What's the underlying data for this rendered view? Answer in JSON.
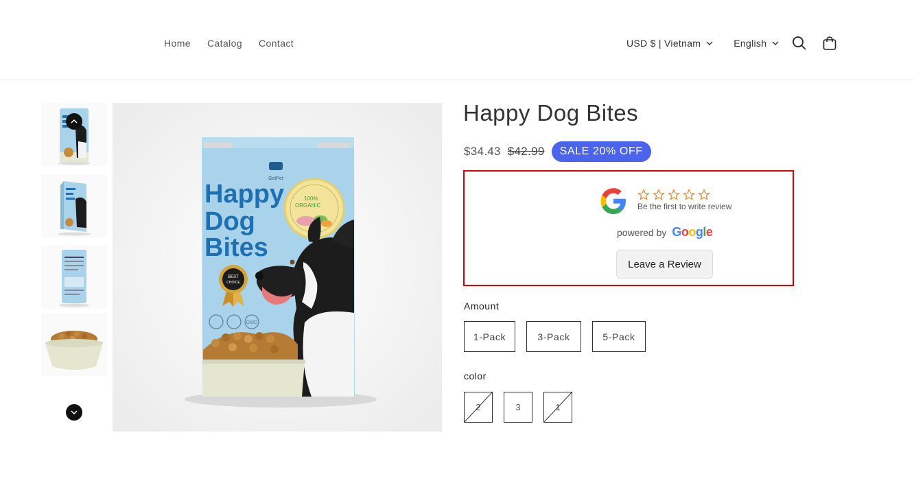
{
  "nav": {
    "home": "Home",
    "catalog": "Catalog",
    "contact": "Contact"
  },
  "header": {
    "currency": "USD $ | Vietnam",
    "language": "English"
  },
  "product": {
    "title": "Happy Dog Bites",
    "price": "$34.43",
    "compare_price": "$42.99",
    "badge": "SALE 20% OFF"
  },
  "package_art": {
    "brand": "GetPet",
    "line1": "Happy",
    "line2": "Dog",
    "line3": "Bites",
    "seal_line1": "100%",
    "seal_line2": "ORGANIC",
    "badge_line1": "BEST",
    "badge_line2": "CHOICE",
    "icon_gmo": "GMO"
  },
  "review": {
    "first_text": "Be the first to write review",
    "powered_by": "powered by",
    "google_word": [
      "G",
      "o",
      "o",
      "g",
      "l",
      "e"
    ],
    "leave_button": "Leave a Review"
  },
  "options": {
    "amount_label": "Amount",
    "amount_values": [
      "1-Pack",
      "3-Pack",
      "5-Pack"
    ],
    "color_label": "color",
    "color_values": [
      "2",
      "3",
      "1"
    ],
    "color_unavailable": [
      true,
      false,
      true
    ]
  },
  "colors": {
    "badge": "#4a64ee",
    "highlight": "#e30000",
    "bag": "#a9d3ea",
    "title_blue": "#1f6fb3"
  }
}
